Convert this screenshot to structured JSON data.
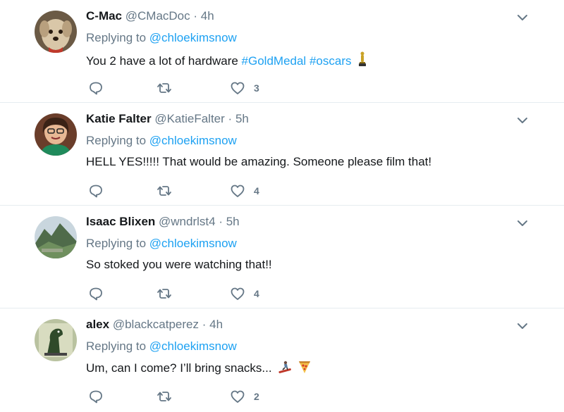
{
  "tweets": [
    {
      "name": "C-Mac",
      "handle": "@CMacDoc",
      "separator": "·",
      "time": "4h",
      "replying_prefix": "Replying to",
      "replying_to": "@chloekimsnow",
      "text": "You 2 have a lot of hardware",
      "hashtags": [
        "#GoldMedal",
        "#oscars"
      ],
      "emoji": "oscar-statue",
      "likes": "3",
      "avatar": "dog-avatar"
    },
    {
      "name": "Katie Falter",
      "handle": "@KatieFalter",
      "separator": "·",
      "time": "5h",
      "replying_prefix": "Replying to",
      "replying_to": "@chloekimsnow",
      "text": "HELL YES!!!!! That would be amazing. Someone please film that!",
      "likes": "4",
      "avatar": "woman-avatar"
    },
    {
      "name": "Isaac Blixen",
      "handle": "@wndrlst4",
      "separator": "·",
      "time": "5h",
      "replying_prefix": "Replying to",
      "replying_to": "@chloekimsnow",
      "text": "So stoked you were watching that!!",
      "likes": "4",
      "avatar": "mountain-avatar"
    },
    {
      "name": "alex",
      "handle": "@blackcatperez",
      "separator": "·",
      "time": "4h",
      "replying_prefix": "Replying to",
      "replying_to": "@chloekimsnow",
      "text": "Um, can I come? I’ll bring snacks...",
      "emojis": [
        "snowboarder",
        "pizza"
      ],
      "likes": "2",
      "avatar": "dinosaur-avatar"
    }
  ],
  "colors": {
    "link": "#1da1f2",
    "muted": "#657786",
    "text": "#14171a",
    "divider": "#e6ecf0"
  }
}
